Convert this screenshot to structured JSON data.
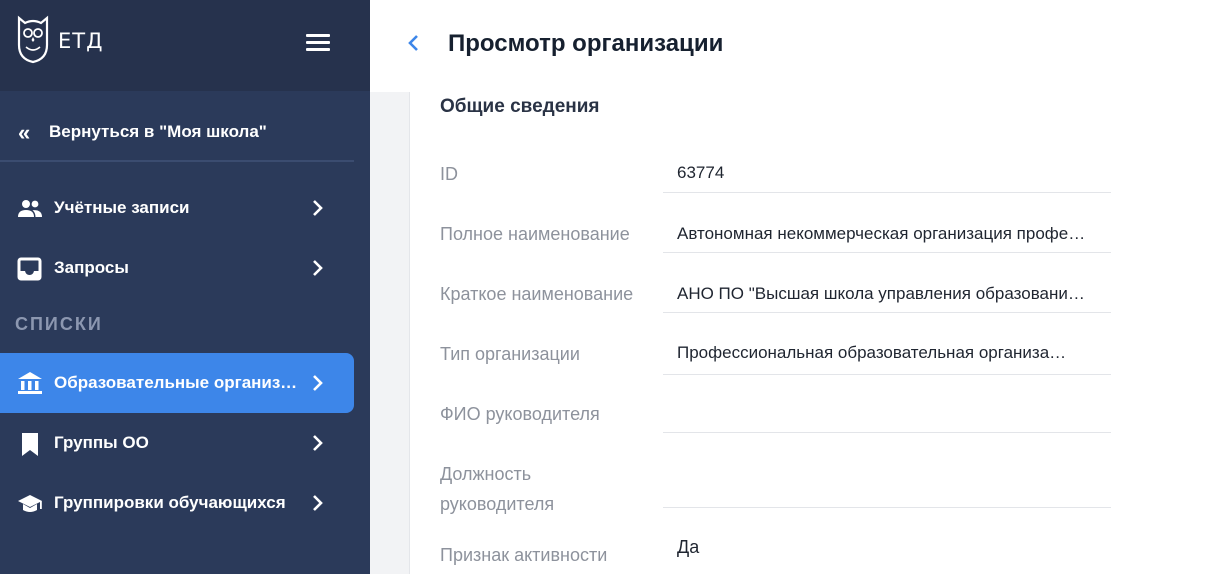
{
  "app": {
    "logo_text": "ЕТД"
  },
  "sidebar": {
    "back_label": "Вернуться в \"Моя школа\"",
    "items": [
      {
        "label": "Учётные записи",
        "icon": "users-icon"
      },
      {
        "label": "Запросы",
        "icon": "inbox-icon"
      }
    ],
    "section_label": "СПИСКИ",
    "list_items": [
      {
        "label": "Образовательные организации",
        "icon": "institution-icon",
        "active": true
      },
      {
        "label": "Группы ОО",
        "icon": "bookmark-icon"
      },
      {
        "label": "Группировки обучающихся",
        "icon": "graduation-cap-icon"
      }
    ]
  },
  "header": {
    "title": "Просмотр организации"
  },
  "details": {
    "section_title": "Общие сведения",
    "rows": [
      {
        "label": "ID",
        "value": "63774"
      },
      {
        "label": "Полное наименование",
        "value": "Автономная некоммерческая организация профессиональная образовательная организация"
      },
      {
        "label": "Краткое наименование",
        "value": "АНО ПО \"Высшая школа управления образованием\""
      },
      {
        "label": "Тип организации",
        "value": "Профессиональная образовательная организация"
      },
      {
        "label": "ФИО руководителя",
        "value": ""
      },
      {
        "label": "Должность руководителя",
        "value": ""
      },
      {
        "label": "Признак активности",
        "value": "Да"
      }
    ]
  },
  "colors": {
    "sidebar": "#2b3a5a",
    "sidebar_header": "#26324d",
    "accent": "#3d86e9"
  }
}
